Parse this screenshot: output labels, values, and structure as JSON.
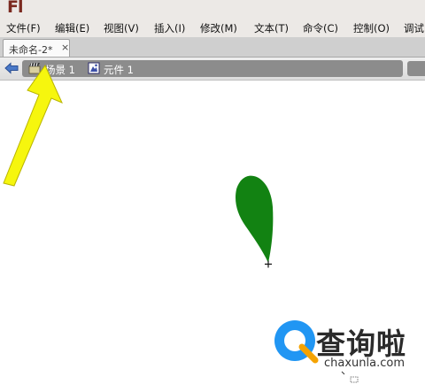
{
  "app": {
    "logo_text": "Fl"
  },
  "menu": {
    "items": [
      "文件(F)",
      "编辑(E)",
      "视图(V)",
      "插入(I)",
      "修改(M)",
      "文本(T)",
      "命令(C)",
      "控制(O)",
      "调试"
    ]
  },
  "document_tab": {
    "label": "未命名-2*",
    "close_glyph": "×"
  },
  "edit_bar": {
    "breadcrumbs": [
      {
        "label": "场景 1",
        "icon": "clapperboard-icon"
      },
      {
        "label": "元件 1",
        "icon": "graphic-symbol-icon"
      }
    ]
  },
  "stage": {
    "shape": {
      "type": "petal",
      "fill": "#128212"
    },
    "registration_mark": "+"
  },
  "annotation": {
    "arrow_color": "#f6f60e"
  },
  "watermark": {
    "brand_cn": "查询啦",
    "url": "chaxunla.com",
    "logo_color": "#2196f3"
  }
}
